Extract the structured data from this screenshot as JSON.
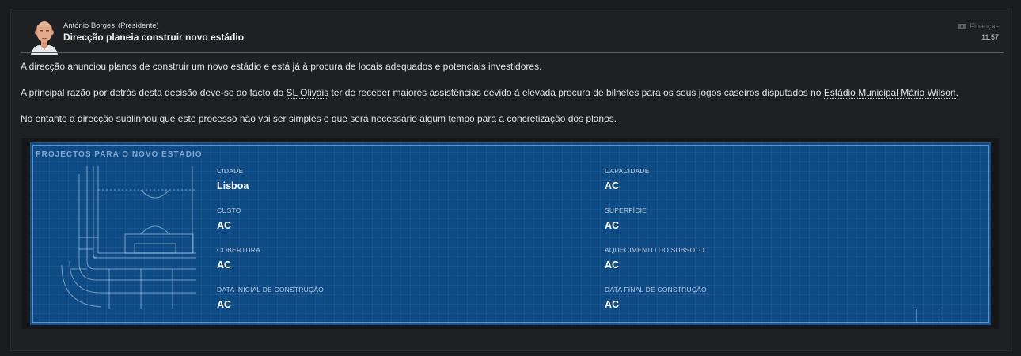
{
  "message": {
    "sender_name": "António Borges",
    "sender_role": "(Presidente)",
    "subject": "Direcção planeia construir novo estádio",
    "category": "Finanças",
    "category_icon": "money-icon",
    "time": "11:57"
  },
  "body": {
    "p1": "A direcção anunciou planos de construir um novo estádio e está já à procura de locais adequados e potenciais investidores.",
    "p2_a": "A principal razão por detrás desta decisão deve-se ao facto do ",
    "p2_link1": "SL Olivais",
    "p2_b": " ter de receber maiores assistências devido à elevada procura de bilhetes para os seus jogos caseiros disputados no ",
    "p2_link2": "Estádio Municipal Mário Wilson",
    "p2_c": ".",
    "p3": "No entanto a direcção sublinhou que este processo não vai ser simples e que será necessário algum tempo para a concretização dos planos."
  },
  "blueprint": {
    "title": "PROJECTOS PARA O NOVO ESTÁDIO",
    "fields": [
      {
        "label": "CIDADE",
        "value": "Lisboa"
      },
      {
        "label": "CAPACIDADE",
        "value": "AC"
      },
      {
        "label": "CUSTO",
        "value": "AC"
      },
      {
        "label": "SUPERFÍCIE",
        "value": "AC"
      },
      {
        "label": "COBERTURA",
        "value": "AC"
      },
      {
        "label": "AQUECIMENTO DO SUBSOLO",
        "value": "AC"
      },
      {
        "label": "DATA INICIAL DE CONSTRUÇÃO",
        "value": "AC"
      },
      {
        "label": "DATA FINAL DE CONSTRUÇÃO",
        "value": "AC"
      }
    ]
  },
  "colors": {
    "background": "#1a1b1d",
    "card": "#1f2023",
    "blueprint": "#0e4a84"
  }
}
